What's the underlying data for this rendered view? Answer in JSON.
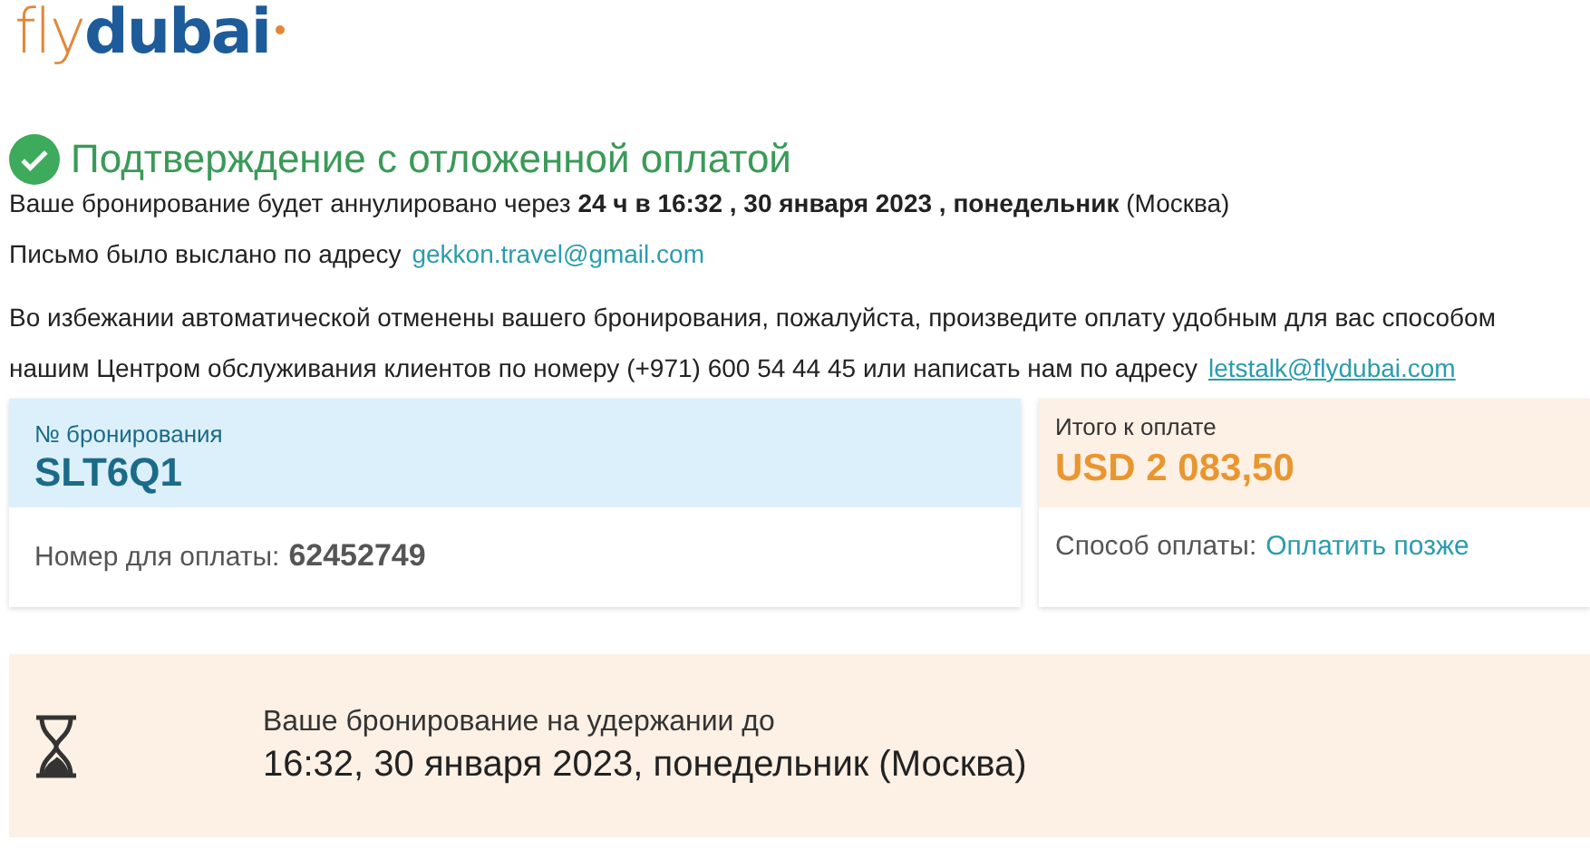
{
  "logo": {
    "parts": [
      "fly",
      "dubai"
    ]
  },
  "heading": {
    "title": "Подтверждение с отложенной оплатой",
    "confirmed": true
  },
  "cancel_notice": "Ваше бронирование будет аннулировано через **24 ч в 16:32 , 30 января 2023 , понедельник** (Москва)",
  "email_notice": {
    "text": "Письмо было выслано по адресу",
    "email": "gekkon.travel@gmail.com"
  },
  "payment_notice": {
    "line_1": "Во избежании автоматической отменены вашего бронирования, пожалуйста, произведите оплату удобным для вас способом",
    "line_2": "нашим Центром обслуживания клиентов по номеру (+971) 600 54 44 45 или написать нам по адресу",
    "email": "letstalk@flydubai.com"
  },
  "booking": {
    "label": "№ бронирования",
    "code": "SLT6Q1",
    "payment_number_label": "Номер для оплаты:",
    "payment_number": "62452749"
  },
  "total": {
    "label": "Итого к оплате",
    "amount": "USD 2 083,50",
    "method_label": "Способ оплаты:",
    "method": "Оплатить позже"
  },
  "hold": {
    "label": "Ваше бронирование на удержании до",
    "until": "16:32, 30 января 2023, понедельник (Москва)"
  }
}
